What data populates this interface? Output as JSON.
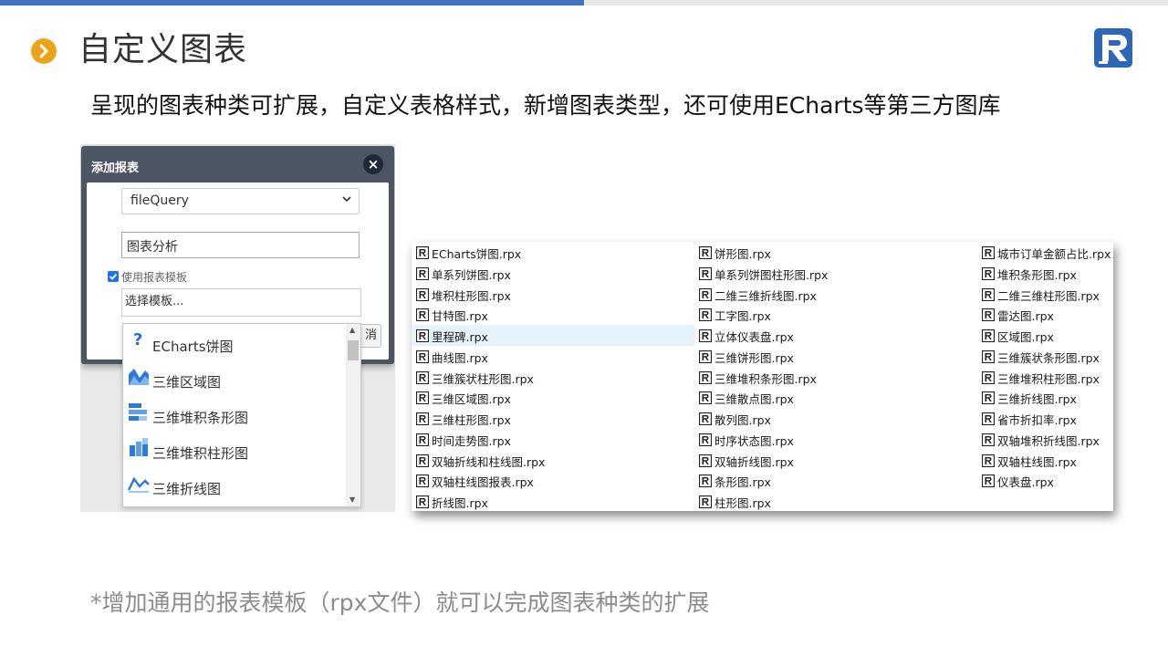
{
  "title": "自定义图表",
  "subtitle": "呈现的图表种类可扩展，自定义表格样式，新增图表类型，还可使用ECharts等第三方图库",
  "footnote": "*增加通用的报表模板（rpx文件）就可以完成图表种类的扩展",
  "colors": {
    "accent_blue": "#3f72c3",
    "bullet_orange": "#eaa31a",
    "logo_blue": "#2e66b8",
    "dialog_header": "#4b5563",
    "selected_row": "#e5f3fb"
  },
  "dialog": {
    "title": "添加报表",
    "close_label": "×",
    "source_select": "fileQuery",
    "name_input": "图表分析",
    "use_template_label": "使用报表模板",
    "use_template_checked": true,
    "template_placeholder": "选择模板...",
    "cancel_label": "消",
    "template_options": [
      {
        "label": "ECharts饼图",
        "icon": "question-icon"
      },
      {
        "label": "三维区域图",
        "icon": "area-chart-3d-icon"
      },
      {
        "label": "三维堆积条形图",
        "icon": "stacked-bar-3d-icon"
      },
      {
        "label": "三维堆积柱形图",
        "icon": "stacked-column-3d-icon"
      },
      {
        "label": "三维折线图",
        "icon": "line-chart-3d-icon"
      }
    ]
  },
  "file_list": {
    "file_icon": "report-file-icon",
    "selected": "里程碑.rpx",
    "columns": [
      [
        "ECharts饼图.rpx",
        "单系列饼图.rpx",
        "堆积柱形图.rpx",
        "甘特图.rpx",
        "里程碑.rpx",
        "曲线图.rpx",
        "三维簇状柱形图.rpx",
        "三维区域图.rpx",
        "三维柱形图.rpx",
        "时间走势图.rpx",
        "双轴折线和柱线图.rpx",
        "双轴柱线图报表.rpx",
        "折线图.rpx"
      ],
      [
        "饼形图.rpx",
        "单系列饼图柱形图.rpx",
        "二维三维折线图.rpx",
        "工字图.rpx",
        "立体仪表盘.rpx",
        "三维饼形图.rpx",
        "三维堆积条形图.rpx",
        "三维散点图.rpx",
        "散列图.rpx",
        "时序状态图.rpx",
        "双轴折线图.rpx",
        "条形图.rpx",
        "柱形图.rpx"
      ],
      [
        "城市订单金额占比.rpx",
        "堆积条形图.rpx",
        "二维三维柱形图.rpx",
        "雷达图.rpx",
        "区域图.rpx",
        "三维簇状条形图.rpx",
        "三维堆积柱形图.rpx",
        "三维折线图.rpx",
        "省市折扣率.rpx",
        "双轴堆积折线图.rpx",
        "双轴柱线图.rpx",
        "仪表盘.rpx"
      ]
    ]
  }
}
